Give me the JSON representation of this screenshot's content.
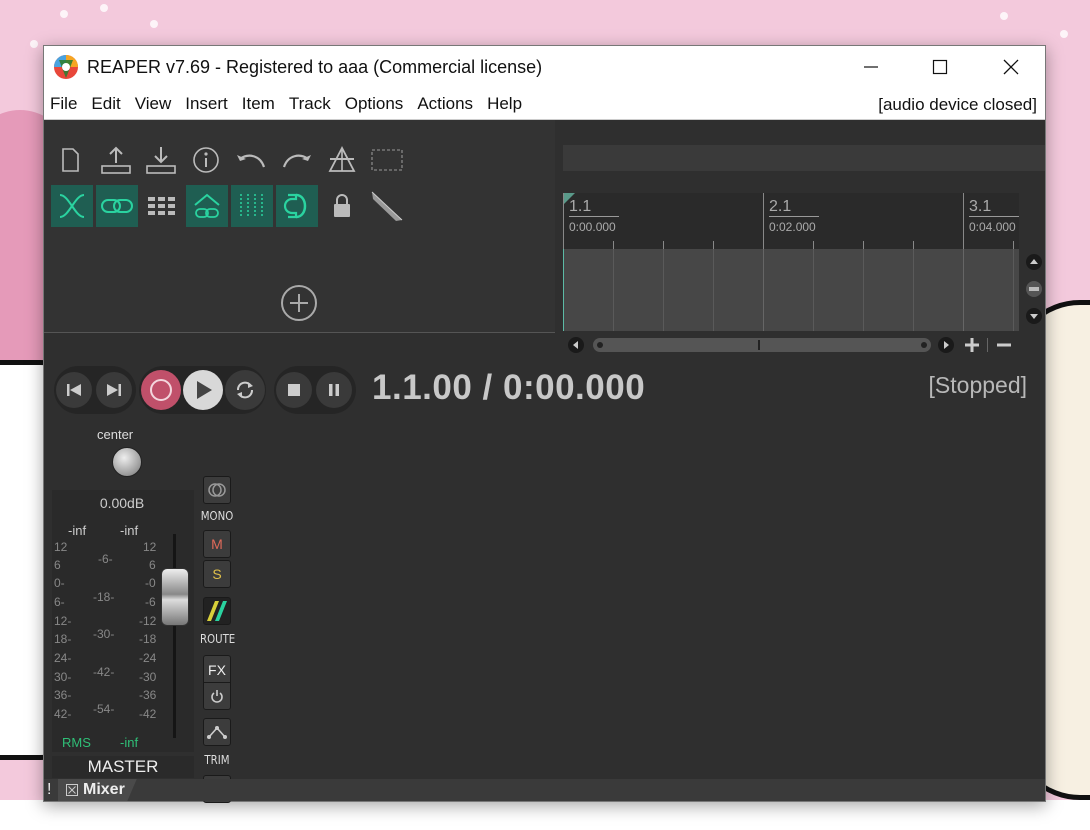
{
  "window": {
    "title": "REAPER v7.69 - Registered to aaa (Commercial license)"
  },
  "menu": {
    "items": [
      "File",
      "Edit",
      "View",
      "Insert",
      "Item",
      "Track",
      "Options",
      "Actions",
      "Help"
    ],
    "audio_status": "[audio device closed]"
  },
  "timeline": {
    "markers": [
      {
        "bar": "1.1",
        "time": "0:00.000"
      },
      {
        "bar": "2.1",
        "time": "0:02.000"
      },
      {
        "bar": "3.1",
        "time": "0:04.000"
      }
    ]
  },
  "transport": {
    "position": "1.1.00 / 0:00.000",
    "state": "[Stopped]"
  },
  "mixer": {
    "pan_label": "center",
    "volume": "0.00dB",
    "peak_left": "-inf",
    "peak_right": "-inf",
    "scale_outer": [
      "12",
      "6",
      "0-",
      "6-",
      "12-",
      "18-",
      "24-",
      "30-",
      "36-",
      "42-"
    ],
    "scale_outer_right": [
      "12",
      "6",
      "-0",
      "-6",
      "-12",
      "-18",
      "-24",
      "-30",
      "-36",
      "-42"
    ],
    "scale_inner": [
      "-6-",
      "-18-",
      "-30-",
      "-42-",
      "-54-"
    ],
    "rms_label": "RMS",
    "rms_value": "-inf",
    "master_name": "MASTER",
    "mono_label": "MONO",
    "mute_label": "M",
    "solo_label": "S",
    "route_label": "ROUTE",
    "fx_label": "FX",
    "trim_label": "TRIM",
    "info_label": "i"
  },
  "status": {
    "bang": "!",
    "mixer_tab": "Mixer"
  },
  "colors": {
    "accent_teal": "#1f5e52",
    "record_red": "#c0506a",
    "rms_green": "#2fbf77"
  }
}
